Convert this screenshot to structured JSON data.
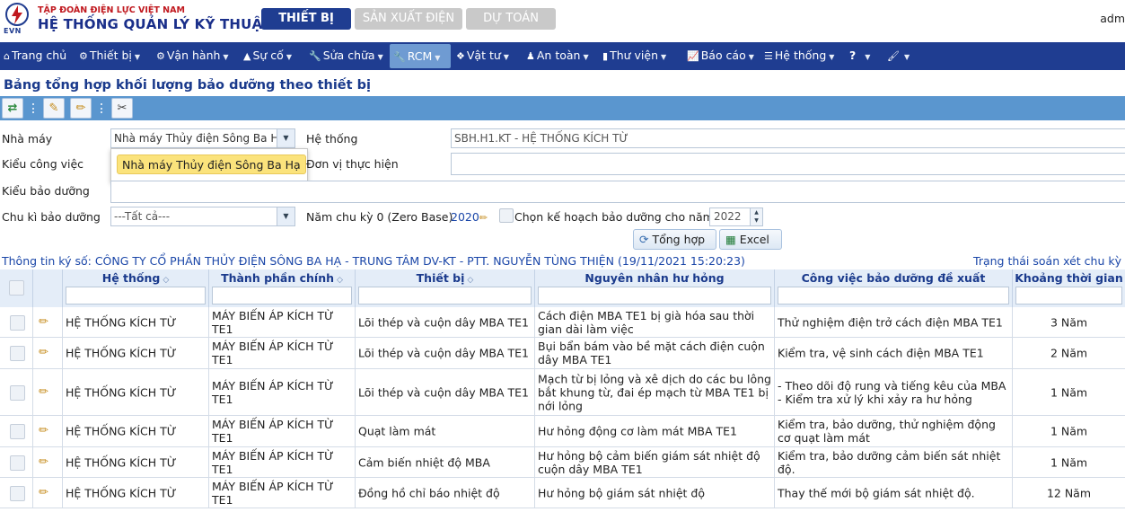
{
  "header": {
    "logo_text": "EVN",
    "org_small": "TẬP ĐOÀN ĐIỆN LỰC VIỆT NAM",
    "org_big": "HỆ THỐNG QUẢN LÝ KỸ THUẬT",
    "tabs": [
      "THIẾT BỊ",
      "SẢN XUẤT ĐIỆN",
      "DỰ TOÁN"
    ],
    "user": "adm"
  },
  "menu": [
    {
      "label": "Trang chủ",
      "icon": "home-icon"
    },
    {
      "label": "Thiết bị",
      "icon": "devices-icon"
    },
    {
      "label": "Vận hành",
      "icon": "gears-icon"
    },
    {
      "label": "Sự cố",
      "icon": "warning-icon"
    },
    {
      "label": "Sửa chữa",
      "icon": "wrench-icon"
    },
    {
      "label": "RCM",
      "icon": "tools-icon"
    },
    {
      "label": "Vật tư",
      "icon": "box-icon"
    },
    {
      "label": "An toàn",
      "icon": "person-icon"
    },
    {
      "label": "Thư viện",
      "icon": "book-icon"
    },
    {
      "label": "Báo cáo",
      "icon": "chart-icon"
    },
    {
      "label": "Hệ thống",
      "icon": "list-icon"
    },
    {
      "label": "?",
      "icon": "help-icon"
    },
    {
      "label": "",
      "icon": "brush-icon"
    }
  ],
  "page_title": "Bảng tổng hợp khối lượng bảo dưỡng theo thiết bị",
  "form": {
    "nha_may_label": "Nhà máy",
    "nha_may_value": "Nhà máy Thủy điện Sông Ba Hạ",
    "nha_may_option": "Nhà máy Thủy điện Sông Ba Hạ",
    "he_thong_label": "Hệ thống",
    "he_thong_value": "SBH.H1.KT - HỆ THỐNG KÍCH TỪ",
    "kieu_cong_viec_label": "Kiểu công việc",
    "don_vi_label": "Đơn vị thực hiện",
    "kieu_bao_duong_label": "Kiểu bảo dưỡng",
    "chu_ki_label": "Chu kì bảo dưỡng",
    "chu_ki_value": "---Tất cả---",
    "nam_chu_ky_label": "Năm chu kỳ 0 (Zero Base)",
    "nam_chu_ky_value": "2020",
    "chon_ke_hoach_label": "Chọn kế hoạch bảo dưỡng cho năm",
    "year_value": "2022",
    "tong_hop_label": "Tổng hợp",
    "excel_label": "Excel"
  },
  "info": {
    "signature": "Thông tin ký số: CÔNG TY CỔ PHẦN THỦY ĐIỆN SÔNG BA HẠ - TRUNG TÂM DV-KT - PTT. NGUYỄN TÙNG THIỆN (19/11/2021 15:20:23)",
    "status": "Trạng thái soán xét chu kỳ"
  },
  "grid": {
    "columns": [
      "Hệ thống",
      "Thành phần chính",
      "Thiết bị",
      "Nguyên nhân hư hỏng",
      "Công việc bảo dưỡng đề xuất",
      "Khoảng thời gian"
    ],
    "rows": [
      [
        "HỆ THỐNG KÍCH TỪ",
        "MÁY BIẾN ÁP KÍCH TỪ TE1",
        "Lõi thép và cuộn dây MBA TE1",
        "Cách điện MBA TE1 bị già hóa sau thời gian dài làm việc",
        "Thử nghiệm điện trở cách điện MBA TE1",
        "3 Năm"
      ],
      [
        "HỆ THỐNG KÍCH TỪ",
        "MÁY BIẾN ÁP KÍCH TỪ TE1",
        "Lõi thép và cuộn dây MBA TE1",
        "Bụi bẩn bám vào bề mặt cách điện cuộn dây MBA TE1",
        "Kiểm tra, vệ sinh cách điện MBA TE1",
        "2 Năm"
      ],
      [
        "HỆ THỐNG KÍCH TỪ",
        "MÁY BIẾN ÁP KÍCH TỪ TE1",
        "Lõi thép và cuộn dây MBA TE1",
        "Mạch từ bị lỏng và xê dịch do các bu lông bắt khung từ, đai ép mạch từ MBA TE1 bị nới lỏng",
        "- Theo dõi độ rung và tiếng kêu của MBA - Kiểm tra xử lý khi xảy ra hư hỏng",
        "1 Năm"
      ],
      [
        "HỆ THỐNG KÍCH TỪ",
        "MÁY BIẾN ÁP KÍCH TỪ TE1",
        "Quạt làm mát",
        "Hư hỏng động cơ làm mát MBA TE1",
        "Kiểm tra, bảo dưỡng, thử nghiệm động cơ quạt làm mát",
        "1 Năm"
      ],
      [
        "HỆ THỐNG KÍCH TỪ",
        "MÁY BIẾN ÁP KÍCH TỪ TE1",
        "Cảm biến nhiệt độ MBA",
        "Hư hỏng bộ cảm biến giám sát nhiệt độ cuộn dây MBA TE1",
        "Kiểm tra, bảo dưỡng cảm biến sát nhiệt độ.",
        "1 Năm"
      ],
      [
        "HỆ THỐNG KÍCH TỪ",
        "MÁY BIẾN ÁP KÍCH TỪ TE1",
        "Đồng hồ chỉ báo nhiệt độ",
        "Hư hỏng bộ giám sát nhiệt độ",
        "Thay thế mới bộ giám sát nhiệt độ.",
        "12 Năm"
      ]
    ]
  }
}
